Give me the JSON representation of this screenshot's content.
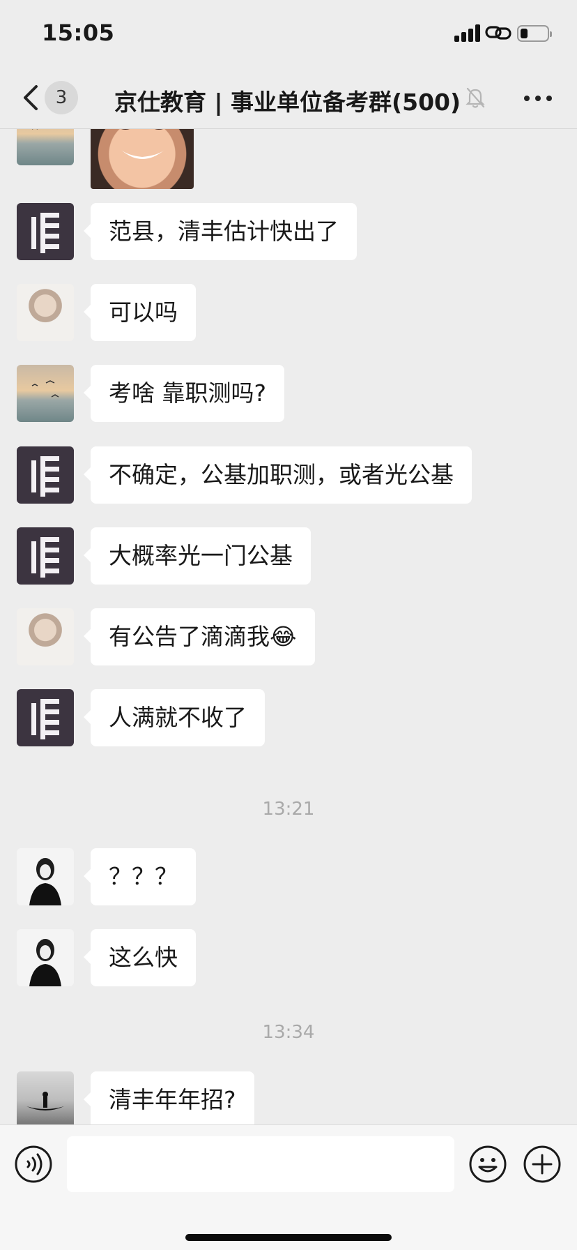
{
  "status_bar": {
    "time": "15:05",
    "icons": [
      "cellular-signal-icon",
      "personal-hotspot-icon",
      "battery-icon"
    ],
    "battery_level_fraction": 0.25
  },
  "nav": {
    "back_icon": "chevron-left-icon",
    "unread_count": "3",
    "title": "京仕教育 | 事业单位备考群(500)",
    "mute_icon": "bell-muted-icon",
    "more_icon": "ellipsis-icon"
  },
  "messages": [
    {
      "type": "image",
      "avatar": "sunset-sea-avatar",
      "content": "smiling-child-photo"
    },
    {
      "type": "text",
      "avatar": "jingshi-logo-avatar",
      "text": "范县，清丰估计快出了"
    },
    {
      "type": "text",
      "avatar": "girl-portrait-avatar",
      "text": "可以吗"
    },
    {
      "type": "text",
      "avatar": "sunset-sea-avatar",
      "text": "考啥 靠职测吗?"
    },
    {
      "type": "text",
      "avatar": "jingshi-logo-avatar",
      "text": "不确定，公基加职测，或者光公基"
    },
    {
      "type": "text",
      "avatar": "jingshi-logo-avatar",
      "text": "大概率光一门公基"
    },
    {
      "type": "text",
      "avatar": "girl-portrait-avatar",
      "text": "有公告了滴滴我😂"
    },
    {
      "type": "text",
      "avatar": "jingshi-logo-avatar",
      "text": "人满就不收了"
    },
    {
      "type": "time",
      "text": "13:21"
    },
    {
      "type": "text",
      "avatar": "bw-sketch-avatar",
      "text": "？？？"
    },
    {
      "type": "text",
      "avatar": "bw-sketch-avatar",
      "text": "这么快"
    },
    {
      "type": "time",
      "text": "13:34"
    },
    {
      "type": "text",
      "avatar": "boat-avatar",
      "text": "清丰年年招?"
    }
  ],
  "input_bar": {
    "voice_icon": "voice-icon",
    "input_value": "",
    "emoji_icon": "emoji-icon",
    "plus_icon": "plus-circle-icon"
  },
  "colors": {
    "background": "#ededed",
    "bubble": "#ffffff",
    "timestamp": "#a9a9a9",
    "logo_avatar": "#3c3440"
  }
}
